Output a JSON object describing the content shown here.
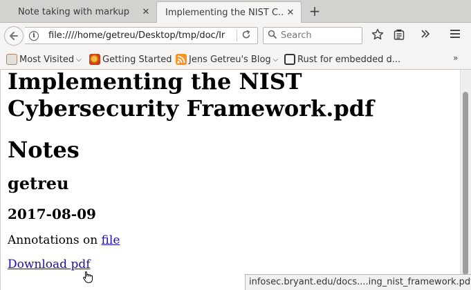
{
  "tabs": [
    {
      "title": "Note taking with markup",
      "close": "✕"
    },
    {
      "title": "Implementing the NIST C...",
      "close": "✕"
    }
  ],
  "new_tab": "+",
  "nav": {
    "back_icon": "back-arrow-icon",
    "url": "file:////home/getreu/Desktop/tmp/doc/Ir",
    "search_placeholder": "Search"
  },
  "bookmarks": [
    {
      "label": "Most Visited",
      "icon": "most-visited-icon",
      "has_menu": true
    },
    {
      "label": "Getting Started",
      "icon": "firefox-icon",
      "has_menu": false
    },
    {
      "label": "Jens Getreu's Blog",
      "icon": "rss-icon",
      "has_menu": true
    },
    {
      "label": "Rust for embedded d...",
      "icon": "rust-icon",
      "has_menu": false
    }
  ],
  "bookmarks_more": "»",
  "document": {
    "title": "Implementing the NIST Cybersecurity Framework.pdf",
    "notes_heading": "Notes",
    "author": "getreu",
    "date": "2017-08-09",
    "annotations_prefix": "Annotations on ",
    "annotations_link": "file",
    "download_link": "Download pdf"
  },
  "status_url": "infosec.bryant.edu/docs....ing_nist_framework.pdf"
}
